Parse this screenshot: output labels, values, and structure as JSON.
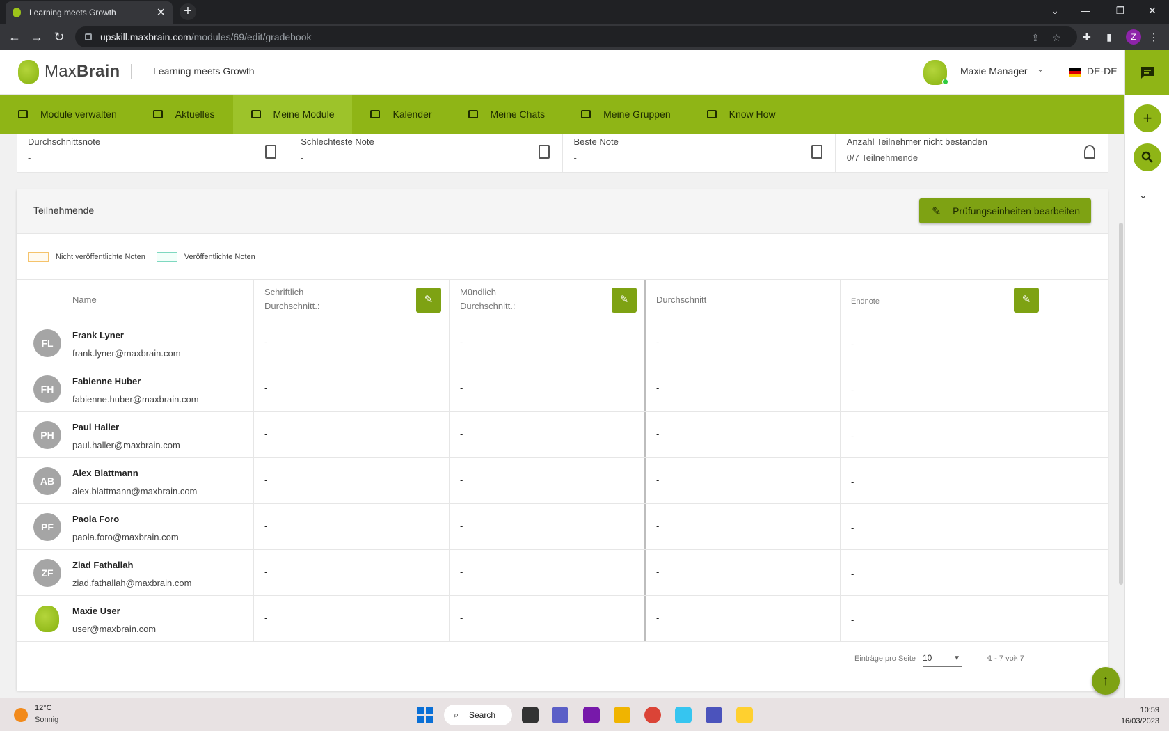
{
  "browser": {
    "tab_title": "Learning meets Growth",
    "url_host": "upskill.maxbrain.com",
    "url_path": "/modules/69/edit/gradebook",
    "profile_initial": "Z"
  },
  "header": {
    "logo_regular": "Max",
    "logo_bold": "Brain",
    "tagline": "Learning meets Growth",
    "user_name": "Maxie Manager",
    "language": "DE-DE"
  },
  "nav": {
    "items": [
      {
        "label": "Module verwalten"
      },
      {
        "label": "Aktuelles"
      },
      {
        "label": "Meine Module"
      },
      {
        "label": "Kalender"
      },
      {
        "label": "Meine Chats"
      },
      {
        "label": "Meine Gruppen"
      },
      {
        "label": "Know How"
      }
    ]
  },
  "stats": [
    {
      "label": "Durchschnittsnote",
      "value": "-"
    },
    {
      "label": "Schlechteste Note",
      "value": "-"
    },
    {
      "label": "Beste Note",
      "value": "-"
    },
    {
      "label": "Anzahl Teilnehmer nicht bestanden",
      "value": "0/7 Teilnehmende"
    }
  ],
  "card": {
    "title": "Teilnehmende",
    "edit_button": "Prüfungseinheiten bearbeiten"
  },
  "legend": {
    "unpublished": "Nicht veröffentlichte Noten",
    "published": "Veröffentlichte Noten",
    "unpublished_color": "#f5c36b",
    "published_color": "#7ed8c0"
  },
  "table": {
    "headers": {
      "name": "Name",
      "written_1": "Schriftlich",
      "written_2": "Durchschnitt.:",
      "oral_1": "Mündlich",
      "oral_2": "Durchschnitt.:",
      "average": "Durchschnitt",
      "final": "Endnote"
    },
    "rows": [
      {
        "initials": "FL",
        "name": "Frank Lyner",
        "email": "frank.lyner@maxbrain.com",
        "written": "-",
        "oral": "-",
        "average": "-",
        "final": "-"
      },
      {
        "initials": "FH",
        "name": "Fabienne Huber",
        "email": "fabienne.huber@maxbrain.com",
        "written": "-",
        "oral": "-",
        "average": "-",
        "final": "-"
      },
      {
        "initials": "PH",
        "name": "Paul Haller",
        "email": "paul.haller@maxbrain.com",
        "written": "-",
        "oral": "-",
        "average": "-",
        "final": "-"
      },
      {
        "initials": "AB",
        "name": "Alex Blattmann",
        "email": "alex.blattmann@maxbrain.com",
        "written": "-",
        "oral": "-",
        "average": "-",
        "final": "-"
      },
      {
        "initials": "PF",
        "name": "Paola Foro",
        "email": "paola.foro@maxbrain.com",
        "written": "-",
        "oral": "-",
        "average": "-",
        "final": "-"
      },
      {
        "initials": "ZF",
        "name": "Ziad Fathallah",
        "email": "ziad.fathallah@maxbrain.com",
        "written": "-",
        "oral": "-",
        "average": "-",
        "final": "-"
      },
      {
        "initials": "",
        "name": "Maxie User",
        "email": "user@maxbrain.com",
        "written": "-",
        "oral": "-",
        "average": "-",
        "final": "-"
      }
    ]
  },
  "pager": {
    "per_page_label": "Einträge pro Seite",
    "per_page_value": "10",
    "range": "1 - 7 von 7"
  },
  "taskbar": {
    "temperature": "12°C",
    "condition": "Sonnig",
    "search_label": "Search",
    "time": "10:59",
    "date": "16/03/2023"
  },
  "colors": {
    "brand_green": "#8fb516",
    "button_green": "#7ea213"
  }
}
